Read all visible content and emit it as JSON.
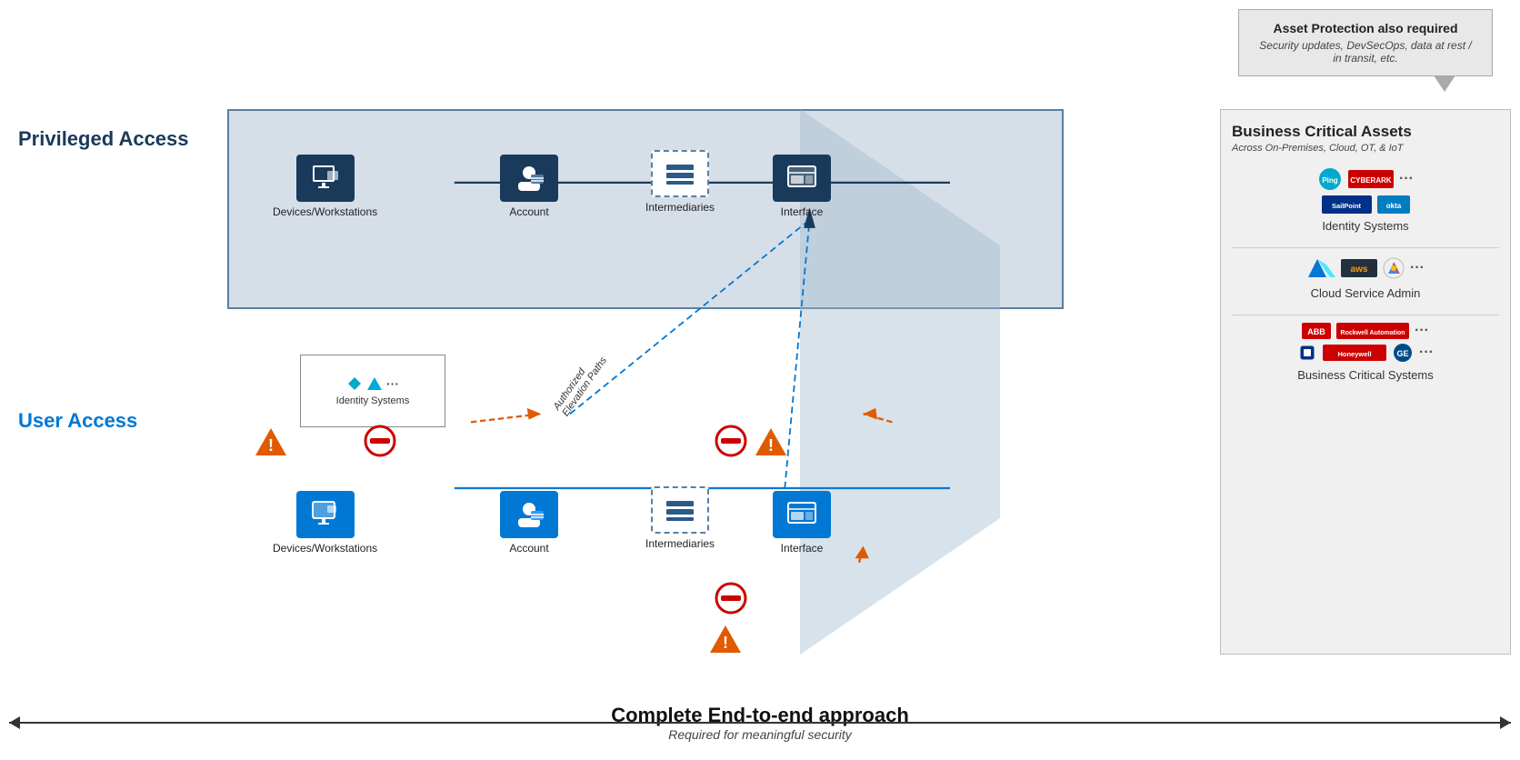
{
  "callout": {
    "title": "Asset Protection also required",
    "subtitle": "Security updates, DevSecOps, data at rest / in transit, etc."
  },
  "privileged_access": {
    "label": "Privileged Access"
  },
  "user_access": {
    "label": "User Access"
  },
  "nodes": {
    "priv_devices": "Devices/Workstations",
    "priv_account": "Account",
    "priv_intermediaries": "Intermediaries",
    "priv_interface": "Interface",
    "user_devices": "Devices/Workstations",
    "user_account": "Account",
    "user_intermediaries": "Intermediaries",
    "user_interface": "Interface",
    "identity_systems": "Identity Systems"
  },
  "elevation_text": "Authorized\nElevation Paths",
  "bca": {
    "title": "Business Critical Assets",
    "subtitle": "Across On-Premises, Cloud, OT, & IoT",
    "sections": [
      {
        "name": "Identity Systems",
        "logos": [
          "Ping",
          "CYBERARK",
          "SailPoint",
          "okta",
          "..."
        ]
      },
      {
        "name": "Cloud Service Admin",
        "logos": [
          "Azure",
          "aws",
          "Google",
          "..."
        ]
      },
      {
        "name": "Business Critical Systems",
        "logos": [
          "ABB",
          "Rockwell Automation",
          "Honeywell",
          "GE",
          "..."
        ]
      }
    ]
  },
  "bottom": {
    "title": "Complete End-to-end approach",
    "subtitle": "Required for meaningful security"
  }
}
